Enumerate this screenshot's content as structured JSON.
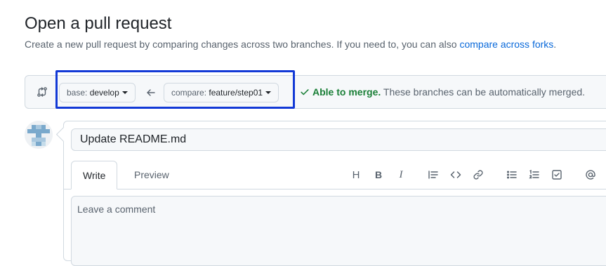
{
  "page": {
    "title": "Open a pull request",
    "subtitle_text": "Create a new pull request by comparing changes across two branches. If you need to, you can also ",
    "subtitle_link": "compare across forks",
    "subtitle_end": "."
  },
  "range": {
    "base_prefix": "base: ",
    "base_branch": "develop",
    "compare_prefix": "compare: ",
    "compare_branch": "feature/step01",
    "merge_ok": "Able to merge.",
    "merge_text": " These branches can be automatically merged."
  },
  "composer": {
    "title_value": "Update README.md",
    "tabs": [
      {
        "label": "Write"
      },
      {
        "label": "Preview"
      }
    ],
    "toolbar": {
      "heading": "H",
      "bold": "B",
      "italic": "I",
      "icons": [
        "heading-icon",
        "bold-icon",
        "italic-icon",
        "quote-icon",
        "code-icon",
        "link-icon",
        "unordered-list-icon",
        "ordered-list-icon",
        "task-list-icon",
        "mention-icon"
      ]
    },
    "comment_placeholder": "Leave a comment"
  },
  "colors": {
    "link": "#0969da",
    "success": "#1a7f37",
    "highlight": "#1239d6"
  }
}
